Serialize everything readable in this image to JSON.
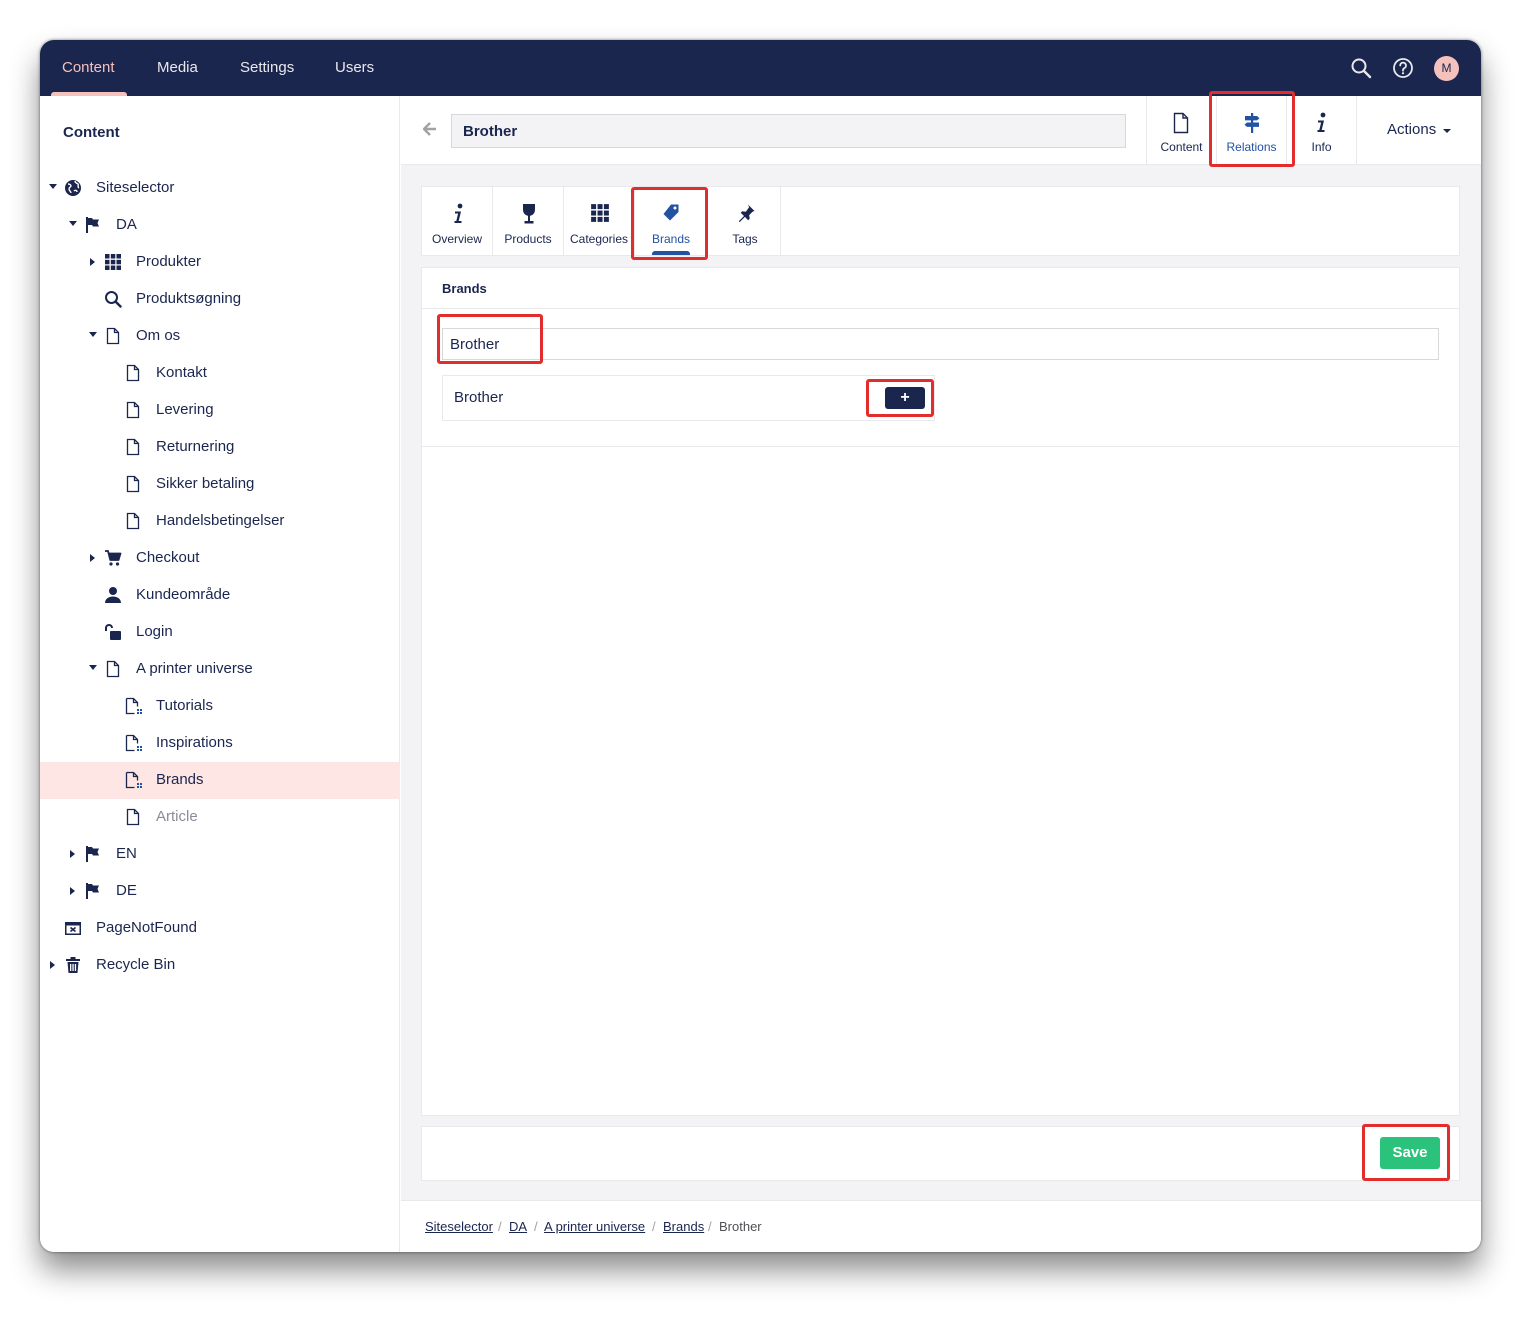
{
  "topnav": {
    "items": [
      {
        "label": "Content"
      },
      {
        "label": "Media"
      },
      {
        "label": "Settings"
      },
      {
        "label": "Users"
      }
    ],
    "avatar_initial": "M"
  },
  "sidebar": {
    "title": "Content",
    "tree": [
      {
        "label": "Siteselector",
        "icon": "globe-icon"
      },
      {
        "label": "DA",
        "icon": "flag-icon"
      },
      {
        "label": "Produkter",
        "icon": "grid-icon"
      },
      {
        "label": "Produktsøgning",
        "icon": "search-icon"
      },
      {
        "label": "Om os",
        "icon": "document-icon"
      },
      {
        "label": "Kontakt",
        "icon": "document-icon"
      },
      {
        "label": "Levering",
        "icon": "document-icon"
      },
      {
        "label": "Returnering",
        "icon": "document-icon"
      },
      {
        "label": "Sikker betaling",
        "icon": "document-icon"
      },
      {
        "label": "Handelsbetingelser",
        "icon": "document-icon"
      },
      {
        "label": "Checkout",
        "icon": "cart-icon"
      },
      {
        "label": "Kundeområde",
        "icon": "user-icon"
      },
      {
        "label": "Login",
        "icon": "unlock-icon"
      },
      {
        "label": "A printer universe",
        "icon": "document-icon"
      },
      {
        "label": "Tutorials",
        "icon": "document-list-icon"
      },
      {
        "label": "Inspirations",
        "icon": "document-list-icon"
      },
      {
        "label": "Brands",
        "icon": "document-list-icon"
      },
      {
        "label": "Article",
        "icon": "document-icon"
      },
      {
        "label": "EN",
        "icon": "flag-icon"
      },
      {
        "label": "DE",
        "icon": "flag-icon"
      },
      {
        "label": "PageNotFound",
        "icon": "window-close-icon"
      },
      {
        "label": "Recycle Bin",
        "icon": "trash-icon"
      }
    ]
  },
  "editor": {
    "name_value": "Brother",
    "apps": [
      {
        "label": "Content",
        "icon": "document-icon"
      },
      {
        "label": "Relations",
        "icon": "signpost-icon"
      },
      {
        "label": "Info",
        "icon": "info-icon"
      }
    ],
    "actions_label": "Actions",
    "subtabs": [
      {
        "label": "Overview",
        "icon": "info-icon"
      },
      {
        "label": "Products",
        "icon": "wine-glass-icon"
      },
      {
        "label": "Categories",
        "icon": "grid-icon"
      },
      {
        "label": "Brands",
        "icon": "tag-icon"
      },
      {
        "label": "Tags",
        "icon": "pin-icon"
      }
    ],
    "panel_title": "Brands",
    "search_value": "Brother",
    "results": [
      {
        "name": "Brother",
        "add_label": "+"
      }
    ],
    "save_label": "Save"
  },
  "breadcrumb": [
    {
      "label": "Siteselector"
    },
    {
      "label": "DA"
    },
    {
      "label": "A printer universe"
    },
    {
      "label": "Brands"
    },
    {
      "label": "Brother"
    }
  ],
  "colors": {
    "navy": "#1b264f",
    "accent_pink": "#f5c1bc",
    "active_blue": "#2152a3",
    "save_green": "#2bc37c",
    "selected_row": "#fde6e3",
    "highlight_red": "#e32c2c"
  }
}
